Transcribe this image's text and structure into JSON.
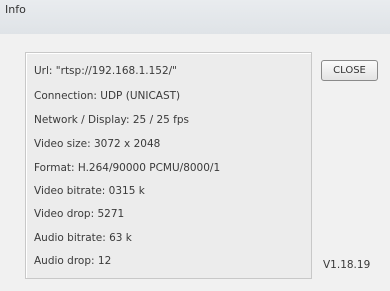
{
  "window": {
    "title": "Info"
  },
  "info": {
    "url": "Url: \"rtsp://192.168.1.152/\"",
    "connection": "Connection: UDP (UNICAST)",
    "network_display": "Network / Display:  25 / 25 fps",
    "video_size": "Video size: 3072 x 2048",
    "format": "Format: H.264/90000 PCMU/8000/1",
    "video_bitrate": "Video bitrate: 0315 k",
    "video_drop": "Video drop: 5271",
    "audio_bitrate": "Audio bitrate: 63 k",
    "audio_drop": "Audio drop: 12"
  },
  "buttons": {
    "close_label": "CLOSE"
  },
  "version": "V1.18.19"
}
